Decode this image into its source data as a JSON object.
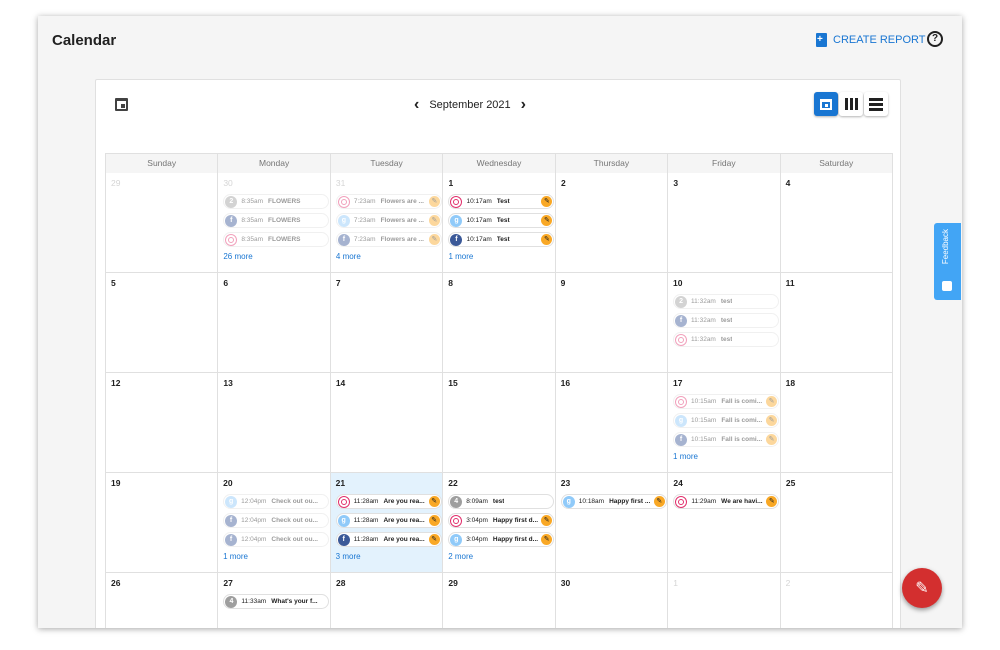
{
  "app": {
    "title": "Calendar",
    "create_report": "CREATE REPORT",
    "help_glyph": "?"
  },
  "toolbar": {
    "month_label": "September 2021",
    "prev": "‹",
    "next": "›"
  },
  "weekdays": [
    "Sunday",
    "Monday",
    "Tuesday",
    "Wednesday",
    "Thursday",
    "Friday",
    "Saturday"
  ],
  "feedback_label": "Feedback",
  "colors": {
    "accent": "#1976d2",
    "fab": "#d32f2f",
    "today": "#e3f2fd",
    "edit_badge": "#f9a825",
    "feedback": "#42a5f5"
  },
  "weeks": [
    [
      {
        "num": "29",
        "outside": true,
        "events": []
      },
      {
        "num": "30",
        "outside": true,
        "events": [
          {
            "net": "nm",
            "glyph": "2",
            "time": "8:35am",
            "text": "FLOWERS",
            "edit": false,
            "faded": true
          },
          {
            "net": "fb",
            "glyph": "f",
            "time": "8:35am",
            "text": "FLOWERS",
            "edit": false,
            "faded": true
          },
          {
            "net": "ig",
            "glyph": "",
            "time": "8:35am",
            "text": "FLOWERS",
            "edit": false,
            "faded": true
          }
        ],
        "more": "26 more"
      },
      {
        "num": "31",
        "outside": true,
        "events": [
          {
            "net": "ig",
            "glyph": "",
            "time": "7:23am",
            "text": "Flowers are ...",
            "edit": true,
            "faded": true
          },
          {
            "net": "grp",
            "glyph": "g",
            "time": "7:23am",
            "text": "Flowers are ...",
            "edit": true,
            "faded": true
          },
          {
            "net": "fb",
            "glyph": "f",
            "time": "7:23am",
            "text": "Flowers are ...",
            "edit": true,
            "faded": true
          }
        ],
        "more": "4 more"
      },
      {
        "num": "1",
        "events": [
          {
            "net": "ig",
            "glyph": "",
            "time": "10:17am",
            "text": "Test",
            "edit": true,
            "faded": false
          },
          {
            "net": "grp",
            "glyph": "g",
            "time": "10:17am",
            "text": "Test",
            "edit": true,
            "faded": false
          },
          {
            "net": "fb",
            "glyph": "f",
            "time": "10:17am",
            "text": "Test",
            "edit": true,
            "faded": false
          }
        ],
        "more": "1 more"
      },
      {
        "num": "2",
        "events": []
      },
      {
        "num": "3",
        "events": []
      },
      {
        "num": "4",
        "events": []
      }
    ],
    [
      {
        "num": "5",
        "events": []
      },
      {
        "num": "6",
        "events": []
      },
      {
        "num": "7",
        "events": []
      },
      {
        "num": "8",
        "events": []
      },
      {
        "num": "9",
        "events": []
      },
      {
        "num": "10",
        "events": [
          {
            "net": "nm",
            "glyph": "2",
            "time": "11:32am",
            "text": "test",
            "edit": false,
            "faded": true
          },
          {
            "net": "fb",
            "glyph": "f",
            "time": "11:32am",
            "text": "test",
            "edit": false,
            "faded": true
          },
          {
            "net": "ig",
            "glyph": "",
            "time": "11:32am",
            "text": "test",
            "edit": false,
            "faded": true
          }
        ]
      },
      {
        "num": "11",
        "events": []
      }
    ],
    [
      {
        "num": "12",
        "events": []
      },
      {
        "num": "13",
        "events": []
      },
      {
        "num": "14",
        "events": []
      },
      {
        "num": "15",
        "events": []
      },
      {
        "num": "16",
        "events": []
      },
      {
        "num": "17",
        "events": [
          {
            "net": "ig",
            "glyph": "",
            "time": "10:15am",
            "text": "Fall is comi...",
            "edit": true,
            "faded": true
          },
          {
            "net": "grp",
            "glyph": "g",
            "time": "10:15am",
            "text": "Fall is comi...",
            "edit": true,
            "faded": true
          },
          {
            "net": "fb",
            "glyph": "f",
            "time": "10:15am",
            "text": "Fall is comi...",
            "edit": true,
            "faded": true
          }
        ],
        "more": "1 more"
      },
      {
        "num": "18",
        "events": []
      }
    ],
    [
      {
        "num": "19",
        "events": []
      },
      {
        "num": "20",
        "events": [
          {
            "net": "grp",
            "glyph": "g",
            "time": "12:04pm",
            "text": "Check out ou...",
            "edit": false,
            "faded": true
          },
          {
            "net": "fb",
            "glyph": "f",
            "time": "12:04pm",
            "text": "Check out ou...",
            "edit": false,
            "faded": true
          },
          {
            "net": "fb",
            "glyph": "f",
            "time": "12:04pm",
            "text": "Check out ou...",
            "edit": false,
            "faded": true
          }
        ],
        "more": "1 more"
      },
      {
        "num": "21",
        "today": true,
        "events": [
          {
            "net": "ig",
            "glyph": "",
            "time": "11:28am",
            "text": "Are you rea...",
            "edit": true,
            "faded": false
          },
          {
            "net": "grp",
            "glyph": "g",
            "time": "11:28am",
            "text": "Are you rea...",
            "edit": true,
            "faded": false
          },
          {
            "net": "fb",
            "glyph": "f",
            "time": "11:28am",
            "text": "Are you rea...",
            "edit": true,
            "faded": false
          }
        ],
        "more": "3 more"
      },
      {
        "num": "22",
        "events": [
          {
            "net": "nm",
            "glyph": "4",
            "time": "8:09am",
            "text": "test",
            "edit": false,
            "faded": false
          },
          {
            "net": "ig",
            "glyph": "",
            "time": "3:04pm",
            "text": "Happy first d...",
            "edit": true,
            "faded": false
          },
          {
            "net": "grp",
            "glyph": "g",
            "time": "3:04pm",
            "text": "Happy first d...",
            "edit": true,
            "faded": false
          }
        ],
        "more": "2 more"
      },
      {
        "num": "23",
        "events": [
          {
            "net": "grp",
            "glyph": "g",
            "time": "10:18am",
            "text": "Happy first ...",
            "edit": true,
            "faded": false
          }
        ]
      },
      {
        "num": "24",
        "events": [
          {
            "net": "ig",
            "glyph": "",
            "time": "11:29am",
            "text": "We are havi...",
            "edit": true,
            "faded": false
          }
        ]
      },
      {
        "num": "25",
        "events": []
      }
    ],
    [
      {
        "num": "26",
        "events": []
      },
      {
        "num": "27",
        "events": [
          {
            "net": "nm",
            "glyph": "4",
            "time": "11:33am",
            "text": "What's your f...",
            "edit": false,
            "faded": false
          }
        ]
      },
      {
        "num": "28",
        "events": []
      },
      {
        "num": "29",
        "events": []
      },
      {
        "num": "30",
        "events": []
      },
      {
        "num": "1",
        "outside": true,
        "events": []
      },
      {
        "num": "2",
        "outside": true,
        "events": []
      }
    ]
  ]
}
